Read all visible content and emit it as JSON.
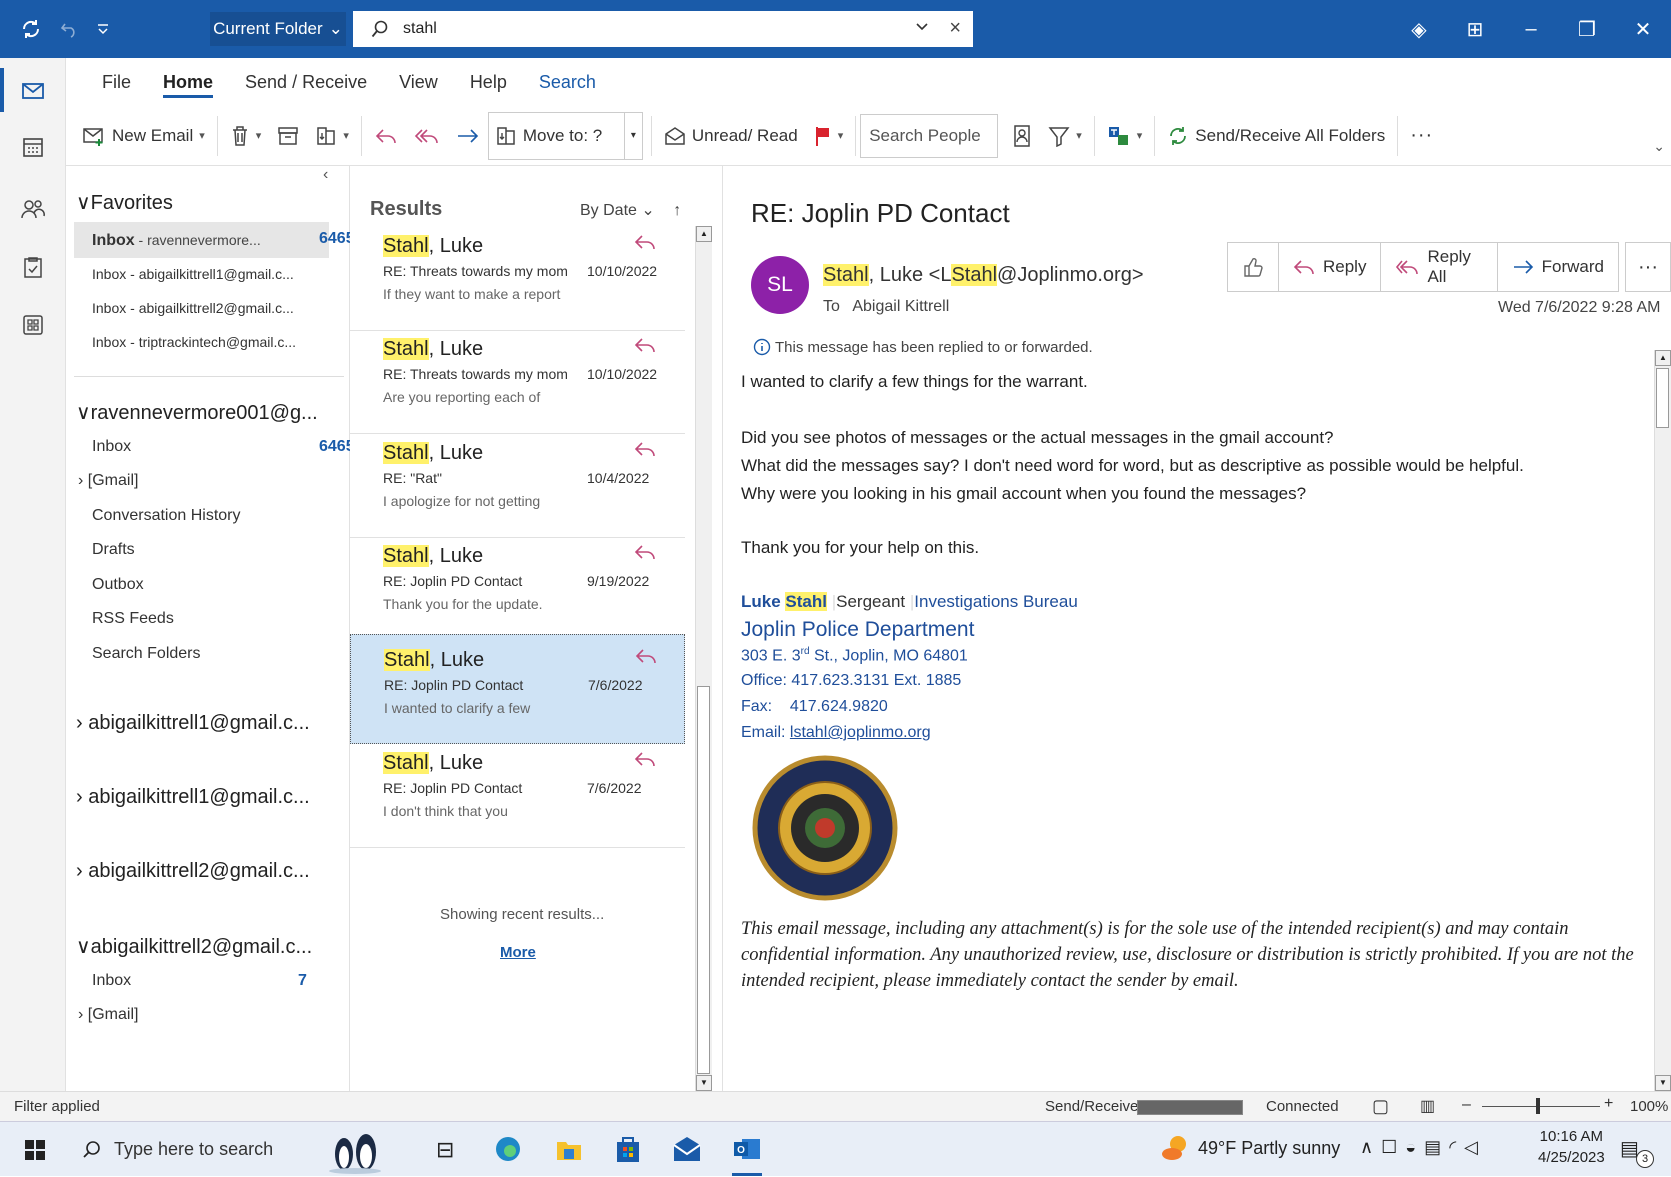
{
  "titlebar": {
    "current_folder": "Current Folder",
    "search_value": "stahl"
  },
  "menu": {
    "tabs": [
      "File",
      "Home",
      "Send / Receive",
      "View",
      "Help",
      "Search"
    ]
  },
  "toolbar": {
    "new_email": "New Email",
    "move_to": "Move to: ?",
    "unread_read": "Unread/ Read",
    "search_people_placeholder": "Search People",
    "send_receive_all": "Send/Receive All Folders"
  },
  "folders": {
    "favorites_label": "Favorites",
    "favorites": [
      {
        "label": "Inbox",
        "suffix": " - ravennevermore...",
        "count": "6465"
      },
      {
        "label": "Inbox - abigailkittrell1@gmail.c..."
      },
      {
        "label": "Inbox - abigailkittrell2@gmail.c..."
      },
      {
        "label": "Inbox - triptrackintech@gmail.c..."
      }
    ],
    "account1": "ravennevermore001@g...",
    "account1_items": [
      {
        "label": "Inbox",
        "count": "6465"
      },
      {
        "label": "[Gmail]"
      },
      {
        "label": "Conversation History"
      },
      {
        "label": "Drafts"
      },
      {
        "label": "Outbox"
      },
      {
        "label": "RSS Feeds"
      },
      {
        "label": "Search Folders"
      }
    ],
    "collapsed_accounts": [
      "abigailkittrell1@gmail.c...",
      "abigailkittrell1@gmail.c...",
      "abigailkittrell2@gmail.c..."
    ],
    "account_last": "abigailkittrell2@gmail.c...",
    "account_last_items": [
      {
        "label": "Inbox",
        "count": "7"
      },
      {
        "label": "[Gmail]"
      }
    ]
  },
  "results": {
    "header": "Results",
    "sort": "By Date",
    "sender_hl": "Stahl",
    "sender_rest": ", Luke",
    "messages": [
      {
        "subject": "RE: Threats towards my mom",
        "preview": "If they want to make a report",
        "date": "10/10/2022"
      },
      {
        "subject": "RE: Threats towards my mom",
        "preview": "Are you reporting each of",
        "date": "10/10/2022"
      },
      {
        "subject": "RE: \"Rat\"",
        "preview": "I apologize for not getting",
        "date": "10/4/2022"
      },
      {
        "subject": "RE: Joplin PD Contact",
        "preview": "Thank you for the update.",
        "date": "9/19/2022"
      },
      {
        "subject": "RE: Joplin PD Contact",
        "preview": "I wanted to clarify a few",
        "date": "7/6/2022"
      },
      {
        "subject": "RE: Joplin PD Contact",
        "preview": "I don't think that you",
        "date": "7/6/2022"
      }
    ],
    "showing": "Showing recent results...",
    "more": "More"
  },
  "reading": {
    "title": "RE: Joplin PD Contact",
    "avatar": "SL",
    "from_hl": "Stahl",
    "from_mid": ", Luke <L",
    "from_hl2": "Stahl",
    "from_end": "@Joplinmo.org>",
    "to_label": "To",
    "to_name": "Abigail Kittrell",
    "reply": "Reply",
    "reply_all": "Reply All",
    "forward": "Forward",
    "date": "Wed 7/6/2022 9:28 AM",
    "info": "This message has been replied to or forwarded.",
    "body": [
      "I wanted to clarify a few things for the warrant.",
      "Did you see photos of messages or the actual messages in the gmail account?",
      "What did the messages say?  I don't need word for word, but as descriptive as possible would be helpful.",
      "Why were you looking in his gmail account when you found the messages?",
      "Thank you for your help on this."
    ],
    "sig": {
      "first": "Luke",
      "last": "Stahl",
      "rank": "Sergeant",
      "bureau": "Investigations Bureau",
      "dept": "Joplin Police Department",
      "addr_a": "303 E. 3",
      "addr_sup": "rd",
      "addr_b": " St., Joplin, MO 64801",
      "office": "Office: 417.623.3131 Ext. 1885",
      "fax": "Fax:    417.624.9820",
      "email_label": "Email: ",
      "email": "lstahl@joplinmo.org"
    },
    "badge": {
      "top": "HONOR",
      "left": "COMMITMENT",
      "right": "COURAGE",
      "bottom": "SERVICE",
      "inner": "CITY OF JOPLIN"
    },
    "disclaimer": "This email message, including any attachment(s) is for the sole use of the intended recipient(s) and may contain confidential information. Any unauthorized review, use, disclosure or distribution is strictly prohibited. If you are not the intended recipient, please immediately contact the sender by email."
  },
  "status": {
    "filter": "Filter applied",
    "send_receive": "Send/Receive",
    "progress": 1.0,
    "connected": "Connected",
    "zoom": "100%"
  },
  "taskbar": {
    "search_placeholder": "Type here to search",
    "weather": "49°F  Partly sunny",
    "time": "10:16 AM",
    "date": "4/25/2023",
    "notif": "3"
  },
  "colors": {
    "accent": "#1a5ba9",
    "highlight": "#fff16b",
    "avatar": "#8d21a8",
    "flag": "#d9232e"
  }
}
